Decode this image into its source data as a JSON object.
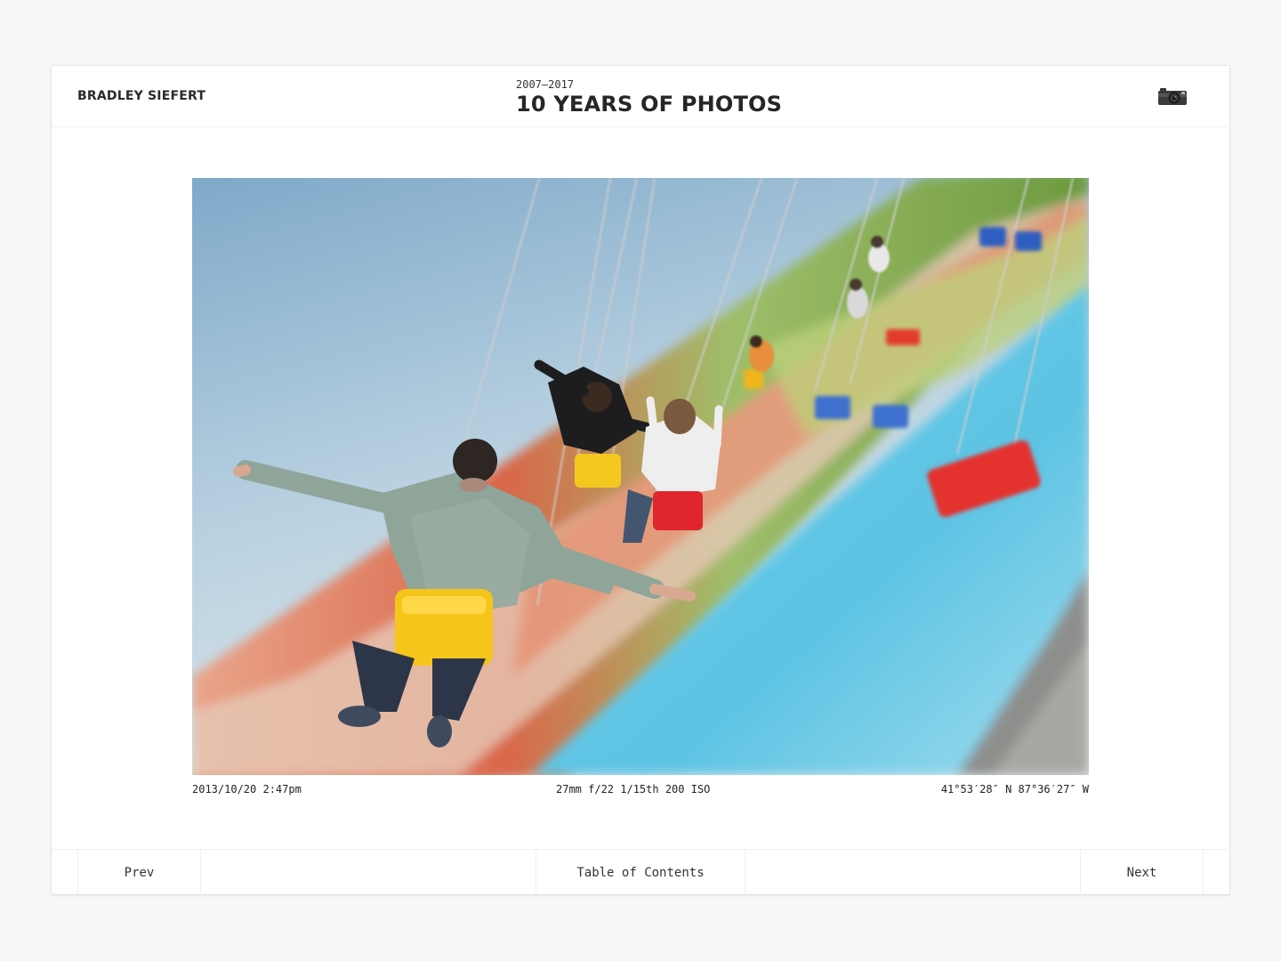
{
  "header": {
    "author": "BRADLEY SIEFERT",
    "years": "2007–2017",
    "title": "10 YEARS OF PHOTOS",
    "camera_icon": "camera-icon"
  },
  "photo": {
    "subject": "swing carousel ride with riders, motion blur",
    "meta": {
      "date": "2013/10/20 2:47pm",
      "exif": "27mm f/22 1/15th 200 ISO",
      "location": "41°53′28″ N 87°36′27″ W"
    }
  },
  "footer": {
    "prev_label": "Prev",
    "toc_label": "Table of Contents",
    "next_label": "Next"
  },
  "colors": {
    "background": "#f7f7f7",
    "card": "#ffffff",
    "sky": "#9fc4da",
    "water": "#5fc3e4"
  }
}
